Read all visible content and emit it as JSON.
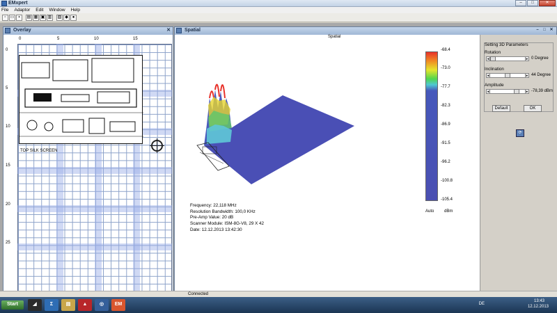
{
  "app": {
    "title": "EMxpert"
  },
  "menu": [
    "File",
    "Adaptor",
    "Edit",
    "Window",
    "Help"
  ],
  "overlay": {
    "title": "Overlay",
    "x_ticks": [
      "0",
      "5",
      "10",
      "15"
    ],
    "y_ticks": [
      "0",
      "5",
      "10",
      "15",
      "20",
      "25"
    ],
    "pcb_label": "TOP SILK SCREEN"
  },
  "spatial": {
    "title": "Spatial",
    "heading": "Spatial",
    "colorbar_ticks": [
      "-68.4",
      "-73.0",
      "-77.7",
      "-82.3",
      "-86.9",
      "-91.5",
      "-96.2",
      "-100.8",
      "-105.4"
    ],
    "colorbar_mode": "Auto",
    "colorbar_unit": "dBm",
    "info": {
      "frequency": "Frequency: 22,118 MHz",
      "rbw": "Resolution Bandwidth: 100,0 KHz",
      "preamp": "Pre-Amp Value: 20 dB",
      "scanner": "Scanner Module: ISM-8G-V8, 29 X 42",
      "date": "Date: 12.12.2013 13:42:30"
    }
  },
  "params": {
    "group_title": "Setting 3D Parameters",
    "rotation_label": "Rotation",
    "rotation_value": "0 Degree",
    "rotation_level": 0.0,
    "inclination_label": "Inclination",
    "inclination_value": "44 Degree",
    "inclination_level": 0.5,
    "amplitude_label": "Amplitude",
    "amplitude_value": "-78,39 dBm",
    "amplitude_level": 0.8,
    "default_label": "Default",
    "ok_label": "OK"
  },
  "status": {
    "text": "Connected"
  },
  "taskbar": {
    "start": "Start",
    "lang": "DE",
    "time": "13:43",
    "date": "12.12.2013"
  }
}
